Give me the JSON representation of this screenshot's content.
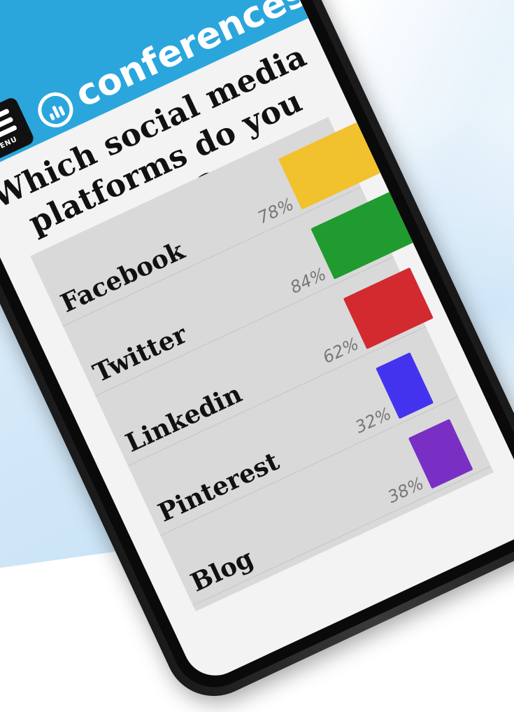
{
  "app": {
    "logo_text": "conferences",
    "menu_label": "MENU"
  },
  "poll": {
    "question": "Which social media platforms do you use?",
    "options": [
      {
        "label": "Facebook",
        "percent": "78%",
        "value": 78,
        "color": "#f2c12e"
      },
      {
        "label": "Twitter",
        "percent": "84%",
        "value": 84,
        "color": "#1f9b2f"
      },
      {
        "label": "Linkedin",
        "percent": "62%",
        "value": 62,
        "color": "#d22a2f"
      },
      {
        "label": "Pinterest",
        "percent": "32%",
        "value": 32,
        "color": "#4433ee"
      },
      {
        "label": "Blog",
        "percent": "38%",
        "value": 38,
        "color": "#7a2fc4"
      }
    ]
  },
  "colors": {
    "header": "#2aa6dd",
    "poll_bg": "#d9d9d9"
  },
  "icons": {
    "menu": "hamburger-icon",
    "logo": "chat-chart-icon"
  }
}
